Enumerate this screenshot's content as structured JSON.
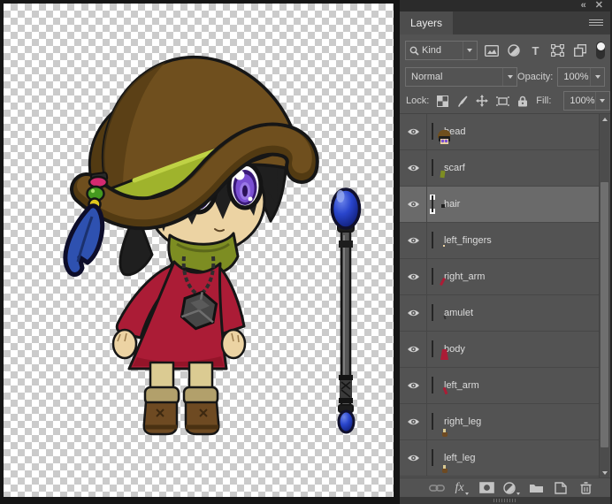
{
  "window": {
    "collapse_glyph": "«",
    "close_glyph": "✕"
  },
  "panel": {
    "tab_label": "Layers",
    "kind_filter": {
      "value": "Kind",
      "search_icon": "search-icon"
    },
    "filter_icons": [
      "pixel-layer-filter-icon",
      "adjustment-layer-filter-icon",
      "type-layer-filter-icon",
      "shape-layer-filter-icon",
      "smart-object-filter-icon",
      "layer-filtering-toggle"
    ],
    "blend_mode": {
      "value": "Normal"
    },
    "opacity": {
      "label": "Opacity:",
      "value": "100%"
    },
    "lock": {
      "label": "Lock:",
      "icons": [
        "lock-transparent-pixels-icon",
        "lock-image-pixels-icon",
        "lock-position-icon",
        "lock-artboard-icon",
        "lock-all-icon"
      ]
    },
    "fill": {
      "label": "Fill:",
      "value": "100%"
    },
    "toolbar": {
      "fx_label": "fx",
      "icons": [
        "link-layers-icon",
        "layer-style-fx-icon",
        "add-layer-mask-icon",
        "new-adjustment-layer-icon",
        "new-group-icon",
        "new-layer-icon",
        "delete-layer-icon"
      ]
    }
  },
  "layers": [
    {
      "name": "head",
      "visible": true,
      "selected": false
    },
    {
      "name": "scarf",
      "visible": true,
      "selected": false
    },
    {
      "name": "hair",
      "visible": true,
      "selected": true
    },
    {
      "name": "left_fingers",
      "visible": true,
      "selected": false
    },
    {
      "name": "right_arm",
      "visible": true,
      "selected": false
    },
    {
      "name": "amulet",
      "visible": true,
      "selected": false
    },
    {
      "name": "body",
      "visible": true,
      "selected": false
    },
    {
      "name": "left_arm",
      "visible": true,
      "selected": false
    },
    {
      "name": "right_leg",
      "visible": true,
      "selected": false
    },
    {
      "name": "left_leg",
      "visible": true,
      "selected": false
    }
  ],
  "canvas": {
    "content": "chibi witch character with floppy brown hat, beads and blue feather, purple eyes, olive scarf, red dress, cube amulet, brown boots; separate staff with blue orb on transparent checkerboard"
  },
  "palette": {
    "panel-bg": "#535353",
    "tab-bg": "#4d4d4d",
    "row-selected": "#6a6a6a",
    "text": "#d8d8d8",
    "field-border": "#6f6f6f",
    "checker": "#cbcbcb",
    "hat": "#6f4f1e",
    "hat-dark": "#523a12",
    "band": "#9fb32c",
    "band-light": "#bfd245",
    "hair": "#1f1f1f",
    "skin": "#ecd3a3",
    "skin-shadow": "#c9a770",
    "iris": "#7a4fd2",
    "iris-light": "#9a78e6",
    "iris-dark": "#3a1a78",
    "scarf": "#7d8d22",
    "scarf-dark": "#5c681a",
    "dress": "#ab1c36",
    "dress-dark": "#8c1226",
    "sock": "#dbcb92",
    "cuff": "#b2a06b",
    "boot": "#6e4a22",
    "boot-dark": "#4a3112",
    "amulet": "#474747",
    "chain": "#2e2e2e",
    "feather": "#2e51b0",
    "bead-pink": "#d42a70",
    "bead-green": "#44991f",
    "bead-yellow": "#e0c71d",
    "staff": "#565656",
    "orb": "#2945cc",
    "orb-deep": "#0d1a70",
    "orb-light": "#6d86ec"
  }
}
